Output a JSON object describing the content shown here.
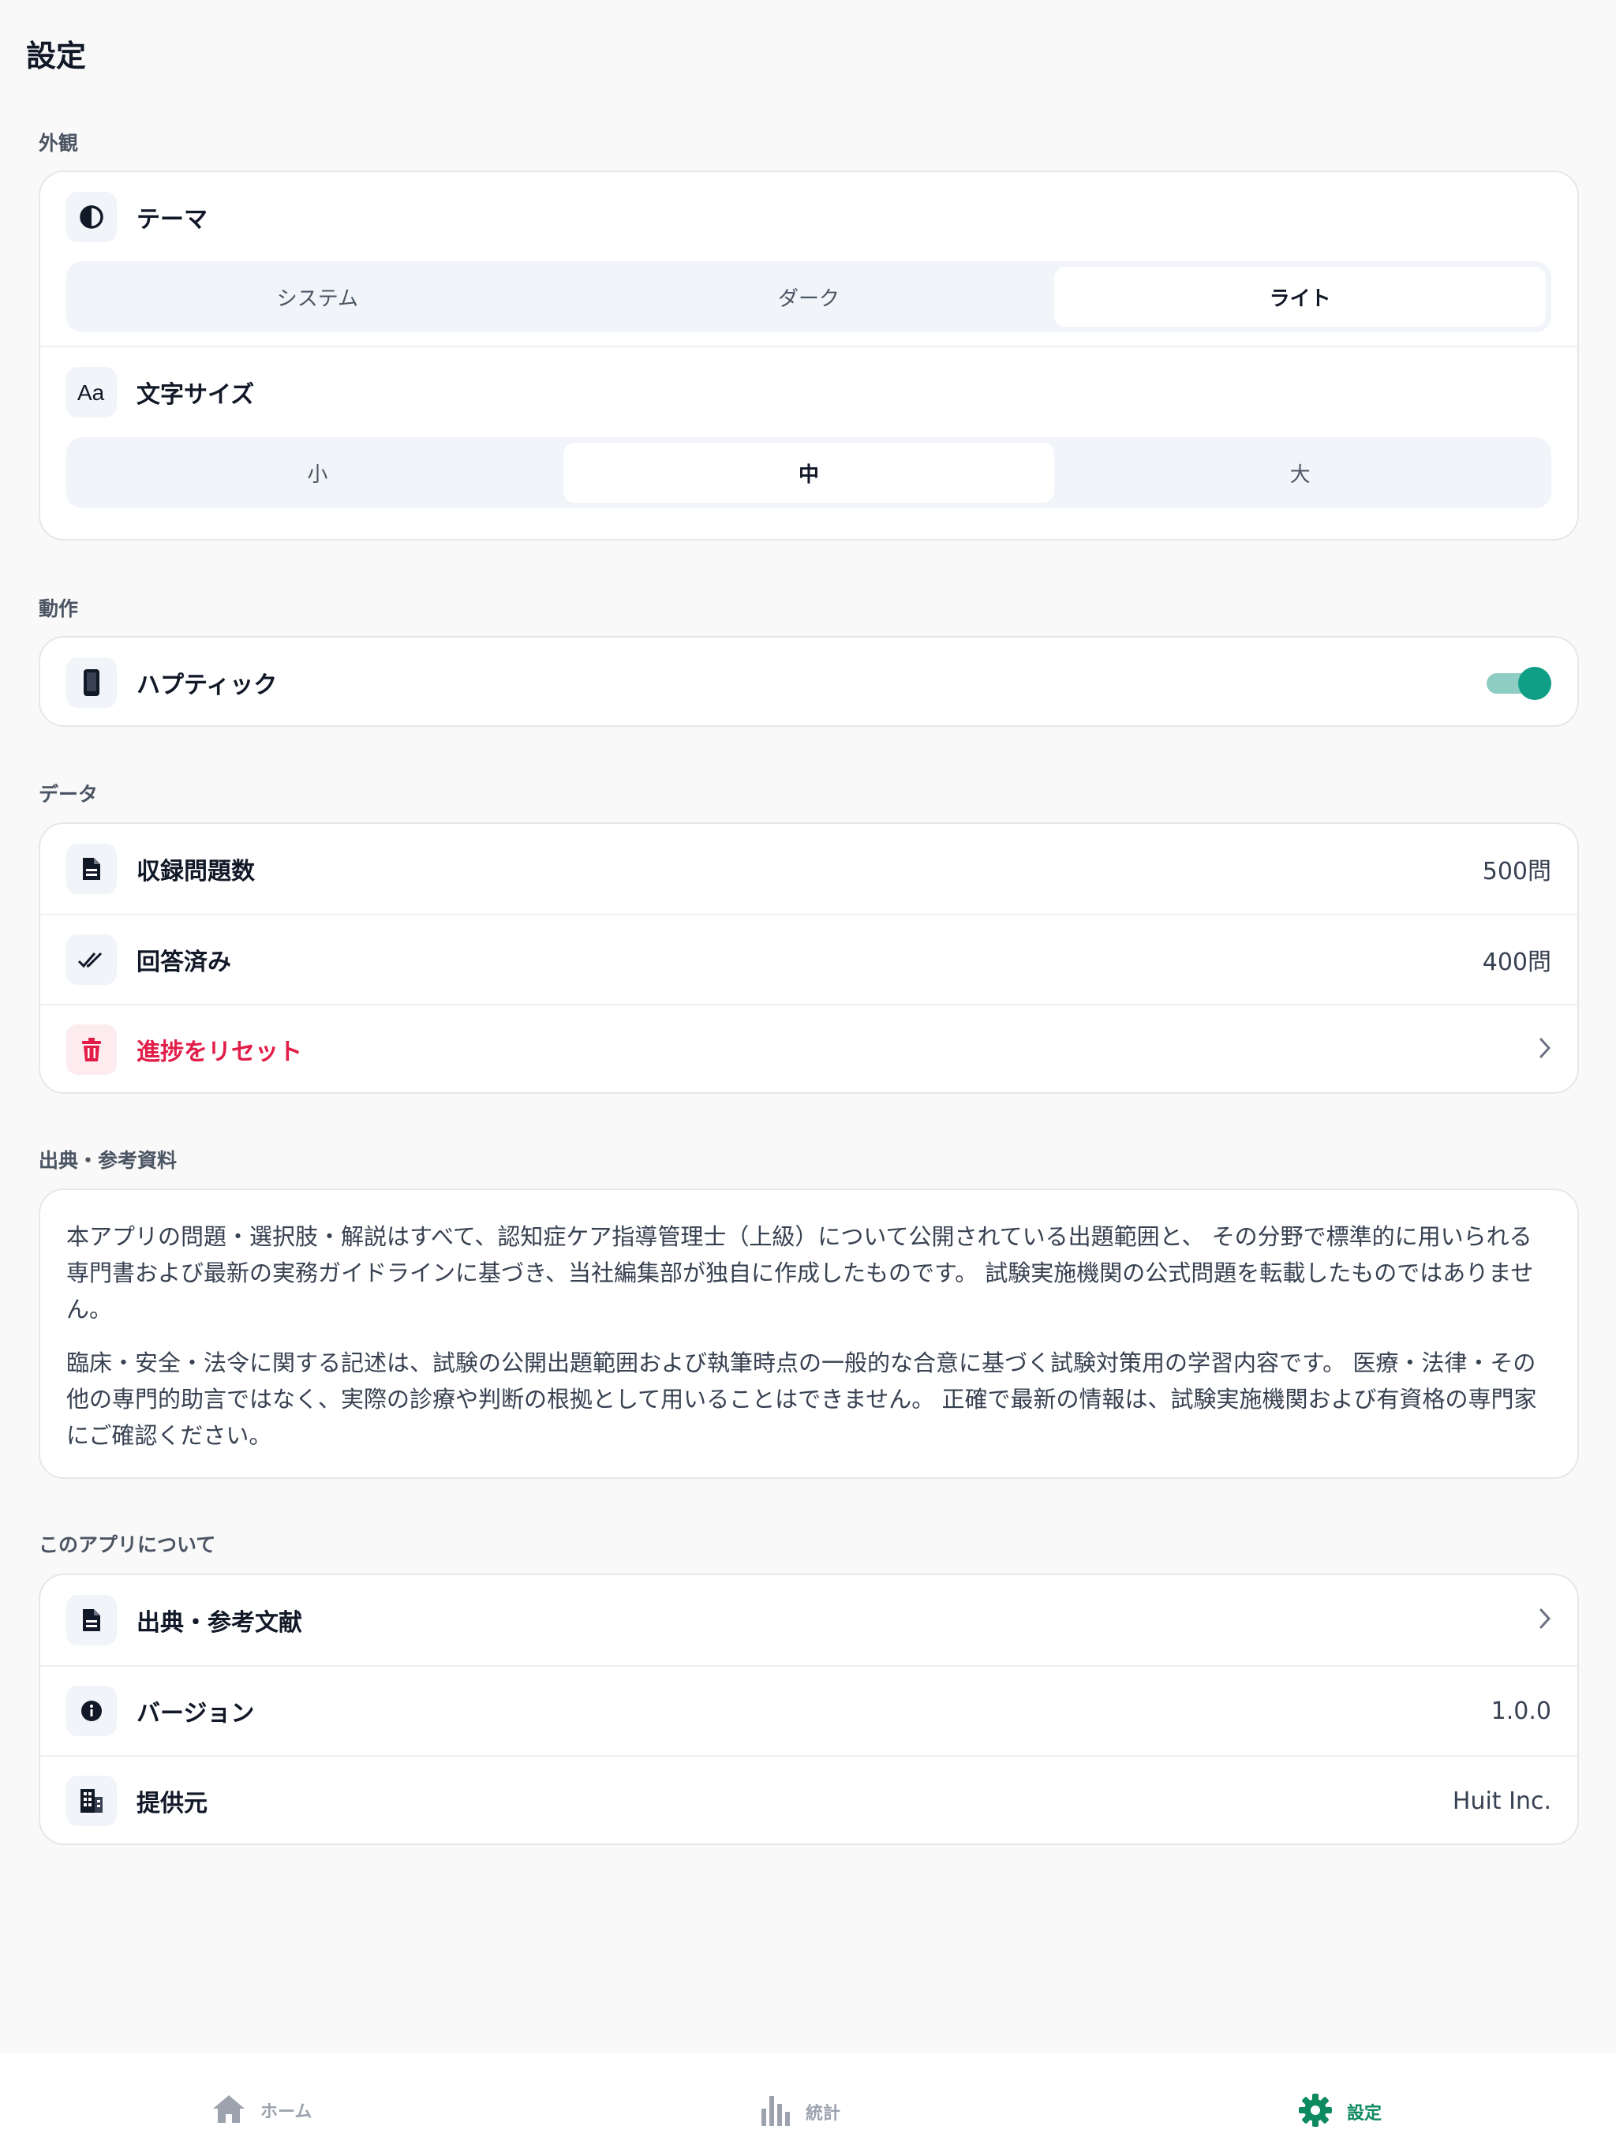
{
  "header": {
    "title": "設定"
  },
  "appearance": {
    "section_title": "外観",
    "theme": {
      "label": "テーマ",
      "icon": "contrast-icon",
      "options": [
        "システム",
        "ダーク",
        "ライト"
      ],
      "selected": "ライト"
    },
    "font_size": {
      "label": "文字サイズ",
      "icon": "text-size-icon",
      "options": [
        "小",
        "中",
        "大"
      ],
      "selected": "中"
    }
  },
  "behavior": {
    "section_title": "動作",
    "haptics": {
      "label": "ハプティック",
      "icon": "phone-icon",
      "enabled": true
    }
  },
  "data": {
    "section_title": "データ",
    "total": {
      "label": "収録問題数",
      "value": "500問",
      "icon": "document-icon"
    },
    "answered": {
      "label": "回答済み",
      "value": "400問",
      "icon": "double-check-icon"
    },
    "reset": {
      "label": "進捗をリセット",
      "icon": "trash-icon"
    }
  },
  "sources": {
    "section_title": "出典・参考資料",
    "paragraphs": [
      "本アプリの問題・選択肢・解説はすべて、認知症ケア指導管理士（上級）について公開されている出題範囲と、 その分野で標準的に用いられる専門書および最新の実務ガイドラインに基づき、当社編集部が独自に作成したものです。 試験実施機関の公式問題を転載したものではありません。",
      "臨床・安全・法令に関する記述は、試験の公開出題範囲および執筆時点の一般的な合意に基づく試験対策用の学習内容です。 医療・法律・その他の専門的助言ではなく、実際の診療や判断の根拠として用いることはできません。 正確で最新の情報は、試験実施機関および有資格の専門家にご確認ください。"
    ]
  },
  "about": {
    "section_title": "このアプリについて",
    "references": {
      "label": "出典・参考文献",
      "icon": "document-icon"
    },
    "version": {
      "label": "バージョン",
      "value": "1.0.0",
      "icon": "info-icon"
    },
    "provider": {
      "label": "提供元",
      "value": "Huit Inc.",
      "icon": "building-icon"
    }
  },
  "tabbar": {
    "tabs": [
      {
        "label": "ホーム",
        "icon": "home-icon"
      },
      {
        "label": "統計",
        "icon": "chart-icon"
      },
      {
        "label": "設定",
        "icon": "gear-icon",
        "active": true
      }
    ]
  },
  "colors": {
    "accent": "#0e8a5f",
    "toggle": "#0e9f86",
    "danger": "#e11d48"
  }
}
